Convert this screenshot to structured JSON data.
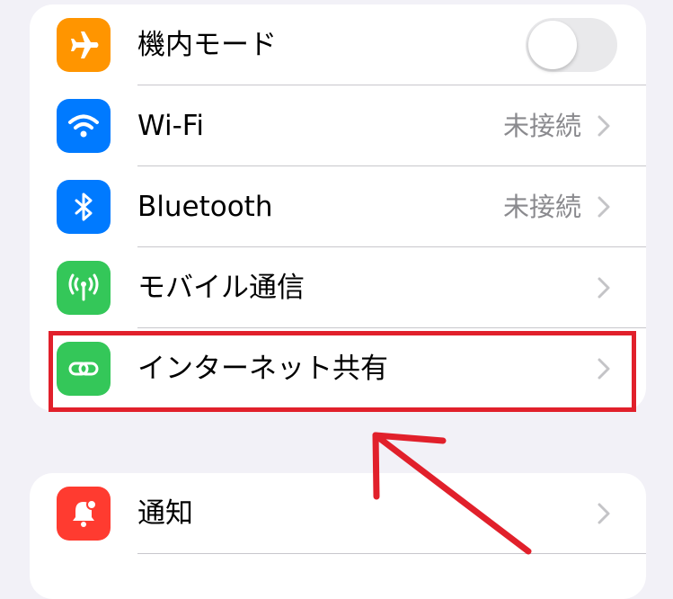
{
  "colors": {
    "airplane": "#ff9500",
    "wifi": "#007aff",
    "bluetooth": "#007aff",
    "cellular": "#34c759",
    "hotspot": "#34c759",
    "notifications": "#ff3b30",
    "annotation": "#e1202b"
  },
  "settings": {
    "airplane": {
      "label": "機内モード",
      "icon": "airplane-icon",
      "toggle_on": false
    },
    "wifi": {
      "label": "Wi-Fi",
      "value": "未接続",
      "icon": "wifi-icon"
    },
    "bluetooth": {
      "label": "Bluetooth",
      "value": "未接続",
      "icon": "bluetooth-icon"
    },
    "cellular": {
      "label": "モバイル通信",
      "icon": "antenna-icon"
    },
    "hotspot": {
      "label": "インターネット共有",
      "icon": "link-icon"
    },
    "notifications": {
      "label": "通知",
      "icon": "bell-icon"
    }
  }
}
